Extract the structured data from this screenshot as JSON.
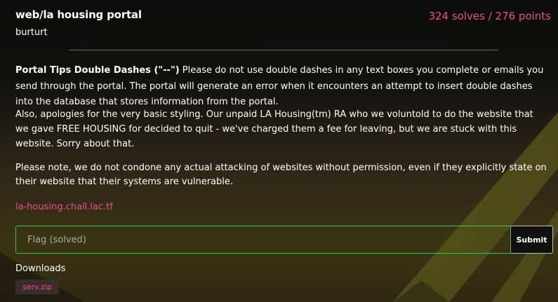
{
  "challenge": {
    "title": "web/la housing portal",
    "author": "burturt",
    "stats": "324 solves / 276 points",
    "description": {
      "bold_heading": "Portal Tips Double Dashes (\"--\")",
      "p1_rest": " Please do not use double dashes in any text boxes you complete or emails you send through the portal. The portal will generate an error when it encounters an attempt to insert double dashes into the database that stores information from the portal.",
      "p2": "Also, apologies for the very basic styling. Our unpaid LA Housing(tm) RA who we voluntold to do the website that we gave FREE HOUSING for decided to quit - we've charged them a fee for leaving, but we are stuck with this website. Sorry about that.",
      "p3": "Please note, we do not condone any actual attacking of websites without permission, even if they explicitly state on their website that their systems are vulnerable."
    },
    "instance_link": "la-housing.chall.lac.tf",
    "flag_form": {
      "placeholder": "Flag (solved)",
      "value": "",
      "submit_label": "Submit"
    },
    "downloads": {
      "label": "Downloads",
      "files": [
        "serv.zip"
      ]
    }
  },
  "colors": {
    "accent_pink": "#ec4d8f",
    "solved_green": "#3fc24a",
    "background": "#0c0c0c",
    "text": "#ffffff"
  }
}
